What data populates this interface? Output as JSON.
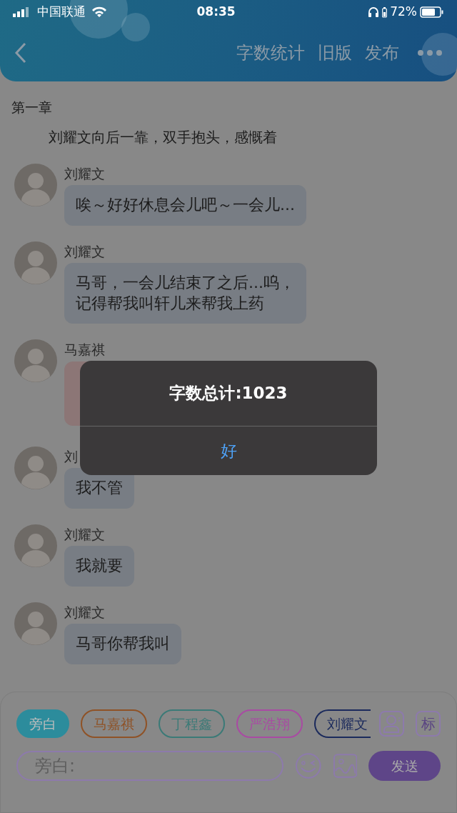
{
  "status_bar": {
    "carrier": "中国联通",
    "time": "08:35",
    "battery_text": "72%"
  },
  "header": {
    "actions": [
      "字数统计",
      "旧版",
      "发布"
    ]
  },
  "chapter": {
    "title": "第一章",
    "narration": "刘耀文向后一靠，双手抱头，感慨着"
  },
  "messages": [
    {
      "speaker": "刘耀文",
      "lines": [
        "唉～好好休息会儿吧～一会儿..."
      ],
      "color": "#787d84"
    },
    {
      "speaker": "刘耀文",
      "lines": [
        "马哥，一会儿结束了之后...呜，",
        "记得帮我叫轩儿来帮我上药"
      ],
      "color": "#787d84"
    },
    {
      "speaker": "马嘉祺",
      "color": "#8c7676"
    },
    {
      "speaker": "刘",
      "color": "#787d84",
      "lines": [
        "我不管"
      ]
    },
    {
      "speaker": "刘耀文",
      "lines": [
        "我就要"
      ],
      "color": "#787d84"
    },
    {
      "speaker": "刘耀文",
      "lines": [
        "马哥你帮我叫"
      ],
      "color": "#787d84"
    }
  ],
  "roles": [
    {
      "label": "旁白",
      "selected": true,
      "color": "#2c8c9c"
    },
    {
      "label": "马嘉祺",
      "selected": false,
      "color": "#8f5226"
    },
    {
      "label": "丁程鑫",
      "selected": false,
      "color": "#3b7a77"
    },
    {
      "label": "严浩翔",
      "selected": false,
      "color": "#a94aa3"
    },
    {
      "label": "刘耀文",
      "selected": false,
      "color": "#1b2a5c"
    }
  ],
  "tag_button": "标",
  "input": {
    "placeholder": "旁白:"
  },
  "send_button": "发送",
  "alert": {
    "message": "字数总计:1023",
    "button": "好"
  }
}
